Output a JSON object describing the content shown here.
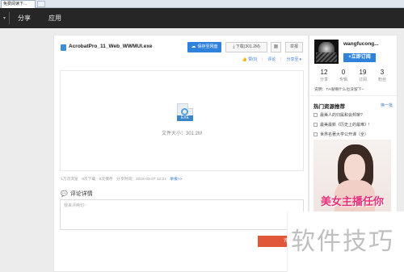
{
  "browser": {
    "tab_title": "免费阅读下..."
  },
  "nav": {
    "items": [
      {
        "label": "分享"
      },
      {
        "label": "应用"
      }
    ]
  },
  "file": {
    "title": "AcrobatPro_11_Web_WWMUI.exe",
    "type_label": "EXE",
    "size_label": "文件大小：301.2M"
  },
  "toolbar": {
    "save_label": "保存至网盘",
    "download_label": "下载(301.2M)",
    "report_label": "举报"
  },
  "actions": {
    "like": "赞(0)",
    "comment": "评论",
    "share": "分享至"
  },
  "meta": {
    "saves": "1万次浏览",
    "downloads": "9次下载",
    "shares": "9次保存",
    "time": "分享时间：2015-03-07 12:21",
    "more": "举报>>"
  },
  "comments": {
    "heading": "评论详情",
    "placeholder": "我来评两句~",
    "submit": "评论"
  },
  "user": {
    "name": "wangfucong...",
    "follow_label": "+立即订阅",
    "stats": [
      {
        "value": "12",
        "label": "分享"
      },
      {
        "value": "0",
        "label": "专辑"
      },
      {
        "value": "19",
        "label": "订阅"
      },
      {
        "value": "3",
        "label": "粉丝"
      }
    ],
    "note": "说明：TA很懒什么也没留下~"
  },
  "hot": {
    "title": "热门资源推荐",
    "refresh": "换一批",
    "items": [
      {
        "label": "最美人的归属和会邦荣?"
      },
      {
        "label": "最美最新《历史上的最难》!"
      },
      {
        "label": "世界名著大学公开课（全）"
      }
    ]
  },
  "ad": {
    "slogan": "美女主播任你聊!"
  },
  "watermark": {
    "text": "软件技巧"
  },
  "colors": {
    "primary": "#2f82dc",
    "nav_bg": "#262626",
    "submit": "#e0573a"
  }
}
